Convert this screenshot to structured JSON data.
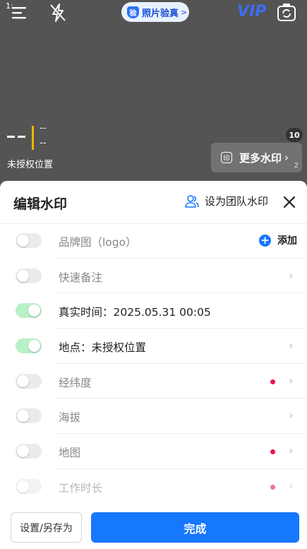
{
  "status": {
    "time": "1:..."
  },
  "topbar": {
    "verify_badge": "验",
    "verify_label": "照片验真",
    "verify_chevron": ">",
    "vip": "VIP",
    "icons": [
      "menu-icon",
      "flash-off-icon",
      "camera-flip-icon"
    ]
  },
  "preview_watermark": {
    "dashes": "– –",
    "line1": "--",
    "line2": "--",
    "location": "未授权位置",
    "accent_color": "#f4b400"
  },
  "more_watermarks": {
    "count": "10",
    "icon_text": "印",
    "label": "更多水印",
    "chevron": "›",
    "sub": "2"
  },
  "panel": {
    "title": "编辑水印",
    "team_label": "设为团队水印",
    "rows": [
      {
        "label": "品牌图（logo）",
        "on": false,
        "action": "添加"
      },
      {
        "label": "快速备注",
        "on": false
      },
      {
        "label": "真实时间：2025.05.31 00:05",
        "on": true
      },
      {
        "label": "地点：未授权位置",
        "on": true
      },
      {
        "label": "经纬度",
        "on": false,
        "dot": true
      },
      {
        "label": "海拔",
        "on": false
      },
      {
        "label": "地图",
        "on": false,
        "dot": true
      },
      {
        "label": "工作时长",
        "on": false,
        "dot": true
      }
    ],
    "chevron": "›",
    "add_symbol": "+"
  },
  "footer": {
    "save_as": "设置/另存为",
    "done": "完成"
  },
  "colors": {
    "primary": "#1677ff",
    "toggle_on": "#b9f0c9",
    "dot": "#e8174a"
  }
}
